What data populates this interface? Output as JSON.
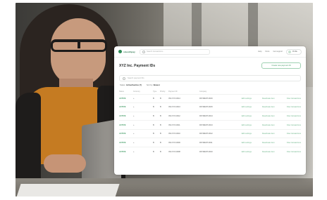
{
  "app": {
    "logo_text": "smoothpay",
    "search_placeholder": "Search transactions...",
    "top_links": [
      "Help",
      "Docs",
      "Get support"
    ],
    "account_label": "Profile",
    "page_title": "XYZ Inc. Payment IDs",
    "new_button_label": "Create new payment ID",
    "filter_placeholder": "Search payment IDs",
    "filters": [
      {
        "label": "Status:",
        "value": "Active/Inactive (7)"
      },
      {
        "label": "Sort by:",
        "value": "Newest"
      }
    ],
    "table": {
      "headers": [
        "Status",
        "Currency",
        "Type",
        "Priority",
        "Payment ID",
        "Company",
        "",
        "",
        ""
      ],
      "rows": [
        [
          "ACTIVE",
          "+",
          "B",
          "B",
          "INV-XYZ-0014",
          "PAYMENT-0016",
          "Edit settings",
          "Deactivate item",
          "View transactions"
        ],
        [
          "ACTIVE",
          "+",
          "B",
          "B",
          "INV-XYZ-0013",
          "PAYMENT-0015",
          "Edit settings",
          "Deactivate item",
          "View transactions"
        ],
        [
          "ACTIVE",
          "+",
          "B",
          "B",
          "INV-XYZ-0012",
          "PAYMENT-0014",
          "Edit settings",
          "Deactivate item",
          "View transactions"
        ],
        [
          "ACTIVE",
          "+",
          "B",
          "B",
          "INV-XYZ-0011",
          "PAYMENT-0013",
          "Edit settings",
          "Deactivate item",
          "View transactions"
        ],
        [
          "ACTIVE",
          "+",
          "B",
          "B",
          "INV-XYZ-0010",
          "PAYMENT-0012",
          "Edit settings",
          "Deactivate item",
          "View transactions"
        ],
        [
          "ACTIVE",
          "+",
          "B",
          "B",
          "INV-XYZ-0009",
          "PAYMENT-0011",
          "Edit settings",
          "Deactivate item",
          "View transactions"
        ],
        [
          "ACTIVE",
          "+",
          "B",
          "B",
          "INV-XYZ-0008",
          "PAYMENT-0010",
          "Edit settings",
          "Deactivate item",
          "View transactions"
        ]
      ]
    }
  },
  "colors": {
    "accent_green": "#3f9a63",
    "sweater_orange": "#c57b22"
  }
}
